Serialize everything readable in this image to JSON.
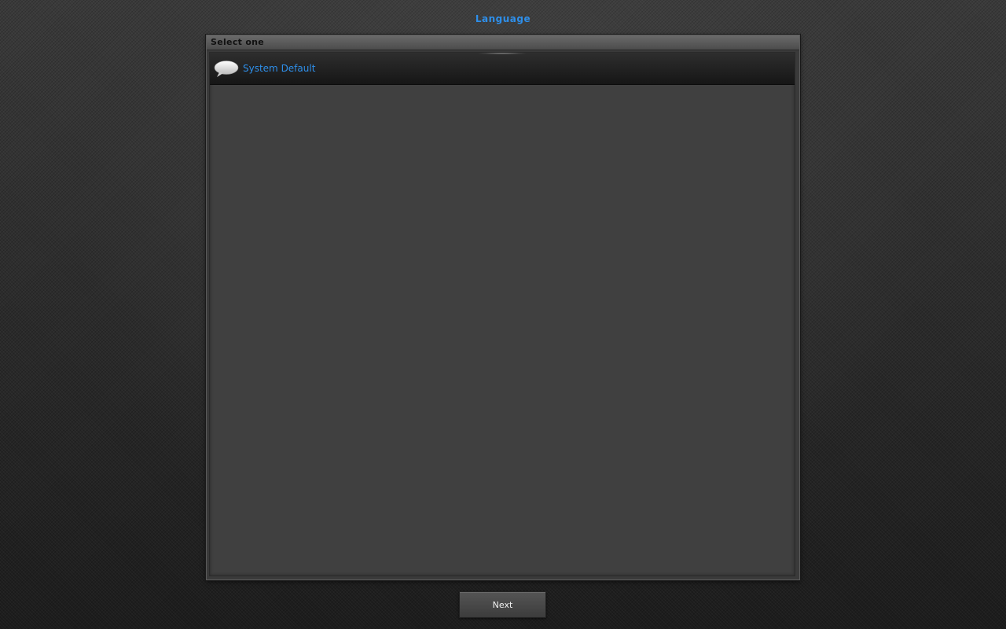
{
  "page": {
    "title": "Language"
  },
  "panel": {
    "header_label": "Select one",
    "items": [
      {
        "label": "System Default",
        "icon": "speech-bubble-icon"
      }
    ]
  },
  "footer": {
    "next_label": "Next"
  },
  "colors": {
    "accent": "#2e8fea",
    "text_dark": "#111111",
    "button_text": "#f0f0f0"
  }
}
